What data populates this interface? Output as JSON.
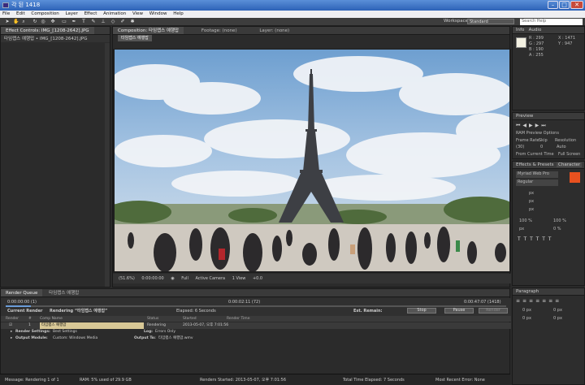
{
  "window": {
    "title": "각 된 1418"
  },
  "menu": [
    "File",
    "Edit",
    "Composition",
    "Layer",
    "Effect",
    "Animation",
    "View",
    "Window",
    "Help"
  ],
  "toolbar": {
    "workspace_label": "Workspace:",
    "workspace_value": "Standard",
    "search_placeholder": "Search Help"
  },
  "project": {
    "tab": "Effect Controls: IMG_[1208-2642].JPG",
    "subtitle": "타임랩스 예행맙 • IMG_[1208-2642].JPG"
  },
  "comp": {
    "tabs": [
      "Composition: 타임랩스 예행맙",
      "Footage: (none)",
      "Layer: (none)"
    ],
    "comp_name": "타임랩스 예행맙",
    "bar": {
      "zoom": "(51.6%)",
      "timecode": "0:00:00:00",
      "resolution": "Full",
      "camera": "Active Camera",
      "view": "1 View",
      "exposure": "+0.0"
    }
  },
  "info": {
    "tabs": [
      "Info",
      "Audio"
    ],
    "r": "R : 299",
    "g": "G : 297",
    "b": "B : 190",
    "a": "A : 255",
    "x": "X : 1471",
    "y": "Y : 947"
  },
  "preview": {
    "title": "Preview",
    "ram": "RAM Preview Options",
    "frame_rate_label": "Frame Rate",
    "skip_label": "Skip",
    "resolution_label": "Resolution",
    "frame_rate": "(30)",
    "skip": "0",
    "resolution": "Auto",
    "from_current": "From Current Time",
    "full_screen": "Full Screen"
  },
  "character": {
    "tabs": [
      "Effects & Presets",
      "Character"
    ],
    "font": "Myriad Web Pro",
    "style": "Regular",
    "size": "px",
    "leading": "px",
    "tracking": "px",
    "scale_v": "100 %",
    "scale_h": "100 %",
    "baseline": "px",
    "tsume": "0 %",
    "brand_color": "#e8511f"
  },
  "paragraph": {
    "title": "Paragraph",
    "indent": "0 px"
  },
  "render_queue": {
    "tabs": [
      "Render Queue",
      "타임랩스 예행맙"
    ],
    "time_start": "0:00:00:00 (1)",
    "time_mid": "0:00:02:11 (72)",
    "time_end": "0:00:47:07 (1418)",
    "current_render": "Current Render",
    "rendering": "Rendering “타임랩스 예행맙”",
    "elapsed": "Elapsed: 6 Seconds",
    "remain": "Est. Remain:",
    "stop": "Stop",
    "pause": "Pause",
    "render": "Render",
    "columns": [
      "Render",
      "#",
      "Comp Name",
      "Status",
      "Started",
      "Render Time"
    ],
    "item": {
      "num": "1",
      "comp": "타임랩스 예행맙",
      "status": "Rendering",
      "started": "2013-05-07, 오후 7:01:56"
    },
    "settings_label": "Render Settings:",
    "settings_value": "Best Settings",
    "log_label": "Log:",
    "log_value": "Errors Only",
    "output_label": "Output Module:",
    "output_value": "Custom: Windows Media",
    "output_to_label": "Output To:",
    "output_to_value": "타임랩스 예행맙.wmv"
  },
  "status": {
    "message": "Message: Rendering 1 of 1",
    "ram": "RAM: 5% used of 29.9 GB",
    "renders_started": "Renders Started: 2013-05-07, 오후 7:01:56",
    "total_elapsed": "Total Time Elapsed: 7 Seconds",
    "recent_error": "Most Recent Error: None"
  }
}
